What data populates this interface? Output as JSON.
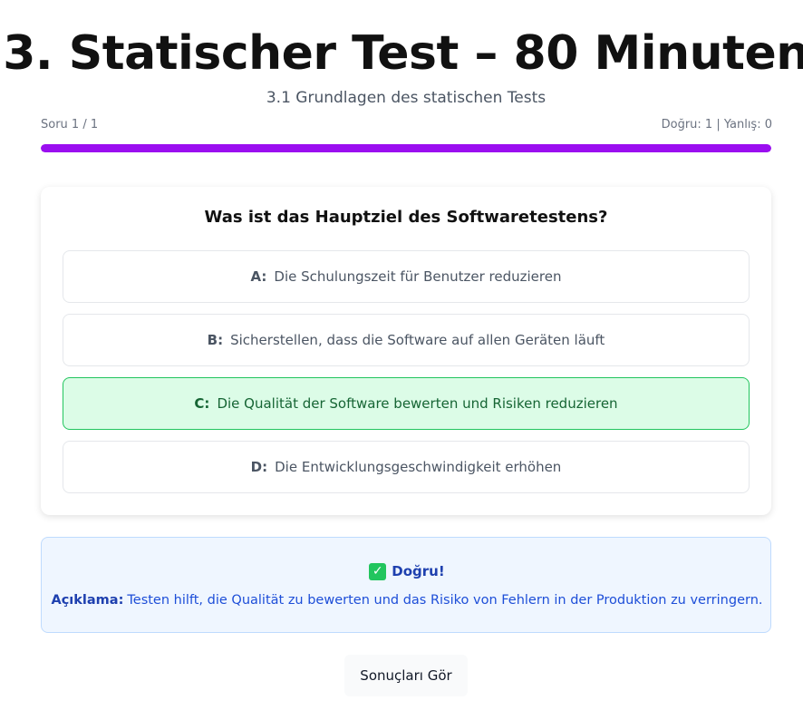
{
  "header": {
    "title": "3. Statischer Test – 80 Minuten",
    "subtitle": "3.1 Grundlagen des statischen Tests"
  },
  "progress": {
    "counter": "Soru 1 / 1",
    "score": "Doğru: 1 | Yanlış: 0",
    "fraction": 1.0,
    "color": "#9b0ef0"
  },
  "quiz": {
    "question": "Was ist das Hauptziel des Softwaretestens?",
    "options": [
      {
        "letter": "A:",
        "text": "Die Schulungszeit für Benutzer reduzieren",
        "state": "neutral"
      },
      {
        "letter": "B:",
        "text": "Sicherstellen, dass die Software auf allen Geräten läuft",
        "state": "neutral"
      },
      {
        "letter": "C:",
        "text": "Die Qualität der Software bewerten und Risiken reduzieren",
        "state": "correct"
      },
      {
        "letter": "D:",
        "text": "Die Entwicklungsgeschwindigkeit erhöhen",
        "state": "neutral"
      }
    ]
  },
  "feedback": {
    "icon": "check-mark-icon",
    "status": "Doğru!",
    "explanation_label": "Açıklama:",
    "explanation": "Testen hilft, die Qualität zu bewerten und das Risiko von Fehlern in der Produktion zu verringern."
  },
  "actions": {
    "results_label": "Sonuçları Gör"
  },
  "colors": {
    "correct_bg": "#dcfce7",
    "correct_border": "#22c55e",
    "feedback_bg": "#eff6ff"
  }
}
